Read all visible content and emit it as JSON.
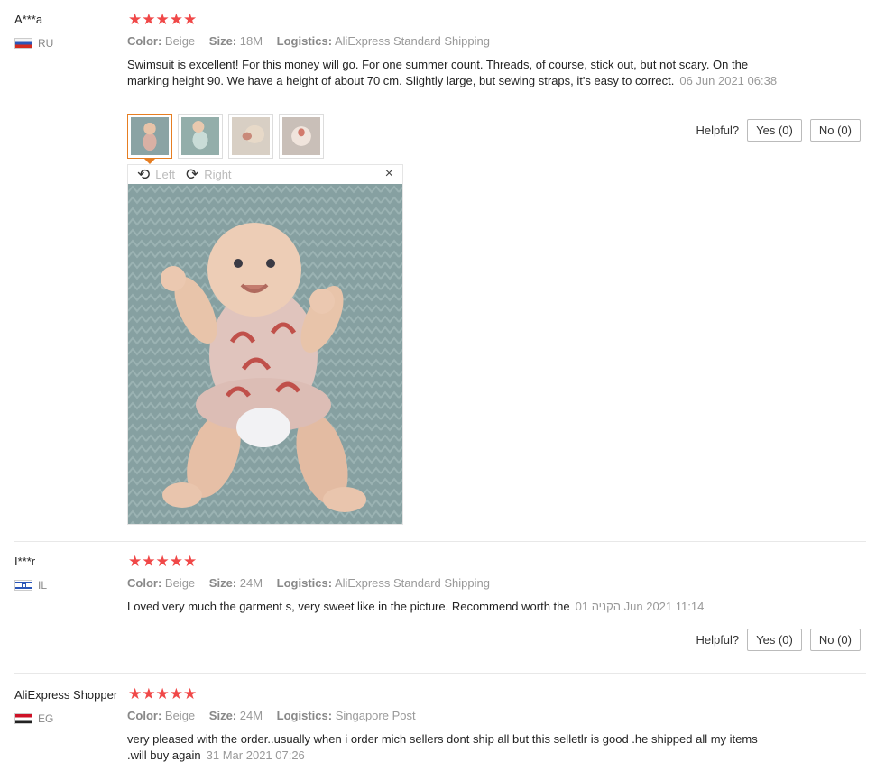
{
  "reviews": [
    {
      "user": "A***a",
      "country": "RU",
      "stars": "★★★★★",
      "color_label": "Color:",
      "color": "Beige",
      "size_label": "Size:",
      "size": "18M",
      "logistics_label": "Logistics:",
      "logistics": "AliExpress Standard Shipping",
      "text": "Swimsuit is excellent! For this money will go. For one summer count. Threads, of course, stick out, but not scary. On the marking height 90. We have a height of about 70 cm. Slightly large, but sewing straps, it's easy to correct.",
      "date": "06 Jun 2021 06:38",
      "helpful_label": "Helpful?",
      "yes_label": "Yes (0)",
      "no_label": "No (0)"
    },
    {
      "user": "I***r",
      "country": "IL",
      "stars": "★★★★★",
      "color_label": "Color:",
      "color": "Beige",
      "size_label": "Size:",
      "size": "24M",
      "logistics_label": "Logistics:",
      "logistics": "AliExpress Standard Shipping",
      "text": "Loved very much the garment s, very sweet like in the picture. Recommend worth the",
      "date": "01 הקניה Jun 2021 11:14",
      "helpful_label": "Helpful?",
      "yes_label": "Yes (0)",
      "no_label": "No (0)"
    },
    {
      "user": "AliExpress Shopper",
      "country": "EG",
      "stars": "★★★★★",
      "color_label": "Color:",
      "color": "Beige",
      "size_label": "Size:",
      "size": "24M",
      "logistics_label": "Logistics:",
      "logistics": "Singapore Post",
      "text": "very pleased with the order..usually when i order mich sellers dont ship all but this selletlr is good .he shipped all my items .will buy again",
      "date": "31 Mar 2021 07:26"
    }
  ],
  "viewer": {
    "rotate_left_label": "Left",
    "rotate_right_label": "Right",
    "close_icon": "×",
    "rotate_left_icon": "⟲",
    "rotate_right_icon": "⟳"
  },
  "colors": {
    "stars": "#f04848",
    "active_thumb_border": "#e67e22",
    "photo_background": "#8fa6a7"
  }
}
